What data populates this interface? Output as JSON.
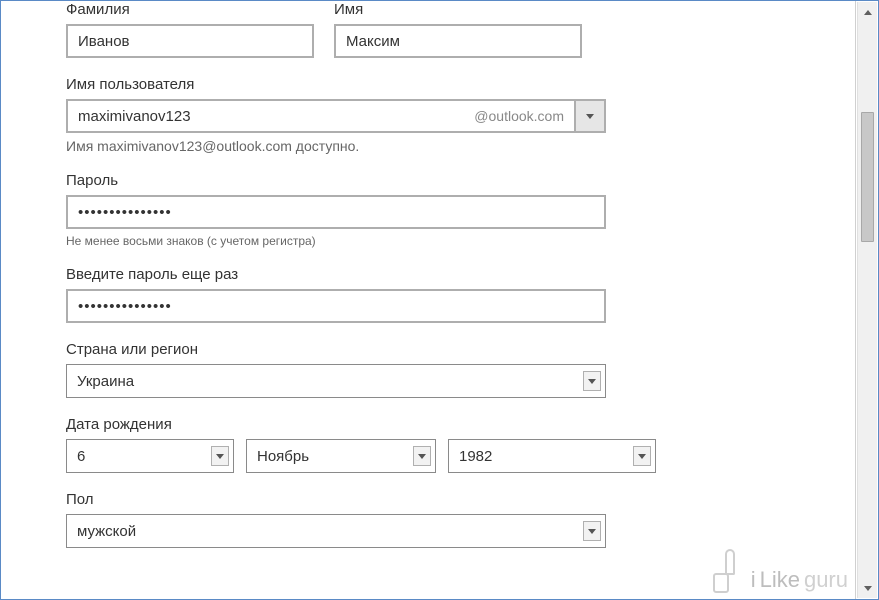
{
  "form": {
    "surname": {
      "label": "Фамилия",
      "value": "Иванов"
    },
    "firstname": {
      "label": "Имя",
      "value": "Максим"
    },
    "username": {
      "label": "Имя пользователя",
      "value": "maximivanov123",
      "domain": "@outlook.com",
      "available_msg": "Имя maximivanov123@outlook.com доступно."
    },
    "password": {
      "label": "Пароль",
      "value": "•••••••••••••••",
      "hint": "Не менее восьми знаков (с учетом регистра)"
    },
    "password_confirm": {
      "label": "Введите пароль еще раз",
      "value": "•••••••••••••••"
    },
    "country": {
      "label": "Страна или регион",
      "value": "Украина"
    },
    "dob": {
      "label": "Дата рождения",
      "day": "6",
      "month": "Ноябрь",
      "year": "1982"
    },
    "gender": {
      "label": "Пол",
      "value": "мужской"
    }
  },
  "watermark": {
    "i": "i",
    "like": "Like",
    "guru": "guru"
  }
}
